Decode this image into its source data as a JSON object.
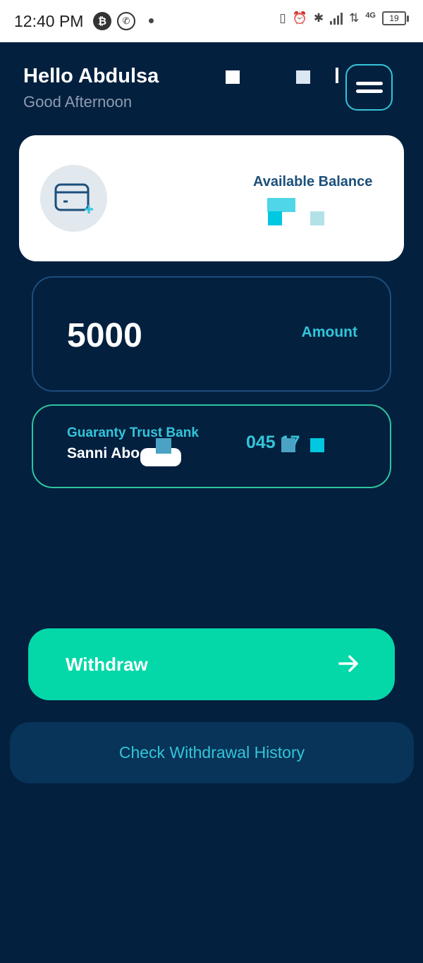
{
  "status_bar": {
    "time": "12:40 PM",
    "battery": "19",
    "network": "4G",
    "icons": [
      "bitcoin-icon",
      "whatsapp-icon",
      "dot-icon",
      "vibrate-icon",
      "alarm-icon",
      "bluetooth-icon",
      "signal-icon",
      "data-arrows-icon",
      "battery-icon"
    ]
  },
  "header": {
    "greeting": "Hello Abdulsa",
    "subtitle": "Good Afternoon",
    "menu_icon": "hamburger-icon"
  },
  "balance_card": {
    "label": "Available Balance",
    "icon": "card-add-icon"
  },
  "amount_card": {
    "value": "5000",
    "label": "Amount"
  },
  "bank_card": {
    "bank_name": "Guaranty Trust Bank",
    "account_name": "Sanni  Abo        na...",
    "account_number": "045            17"
  },
  "withdraw_button": {
    "label": "Withdraw",
    "icon": "arrow-right-icon"
  },
  "history_button": {
    "label": "Check Withdrawal History"
  },
  "colors": {
    "background": "#03203f",
    "accent_cyan": "#33c5d9",
    "accent_green": "#04d8a9",
    "card_white": "#ffffff"
  }
}
